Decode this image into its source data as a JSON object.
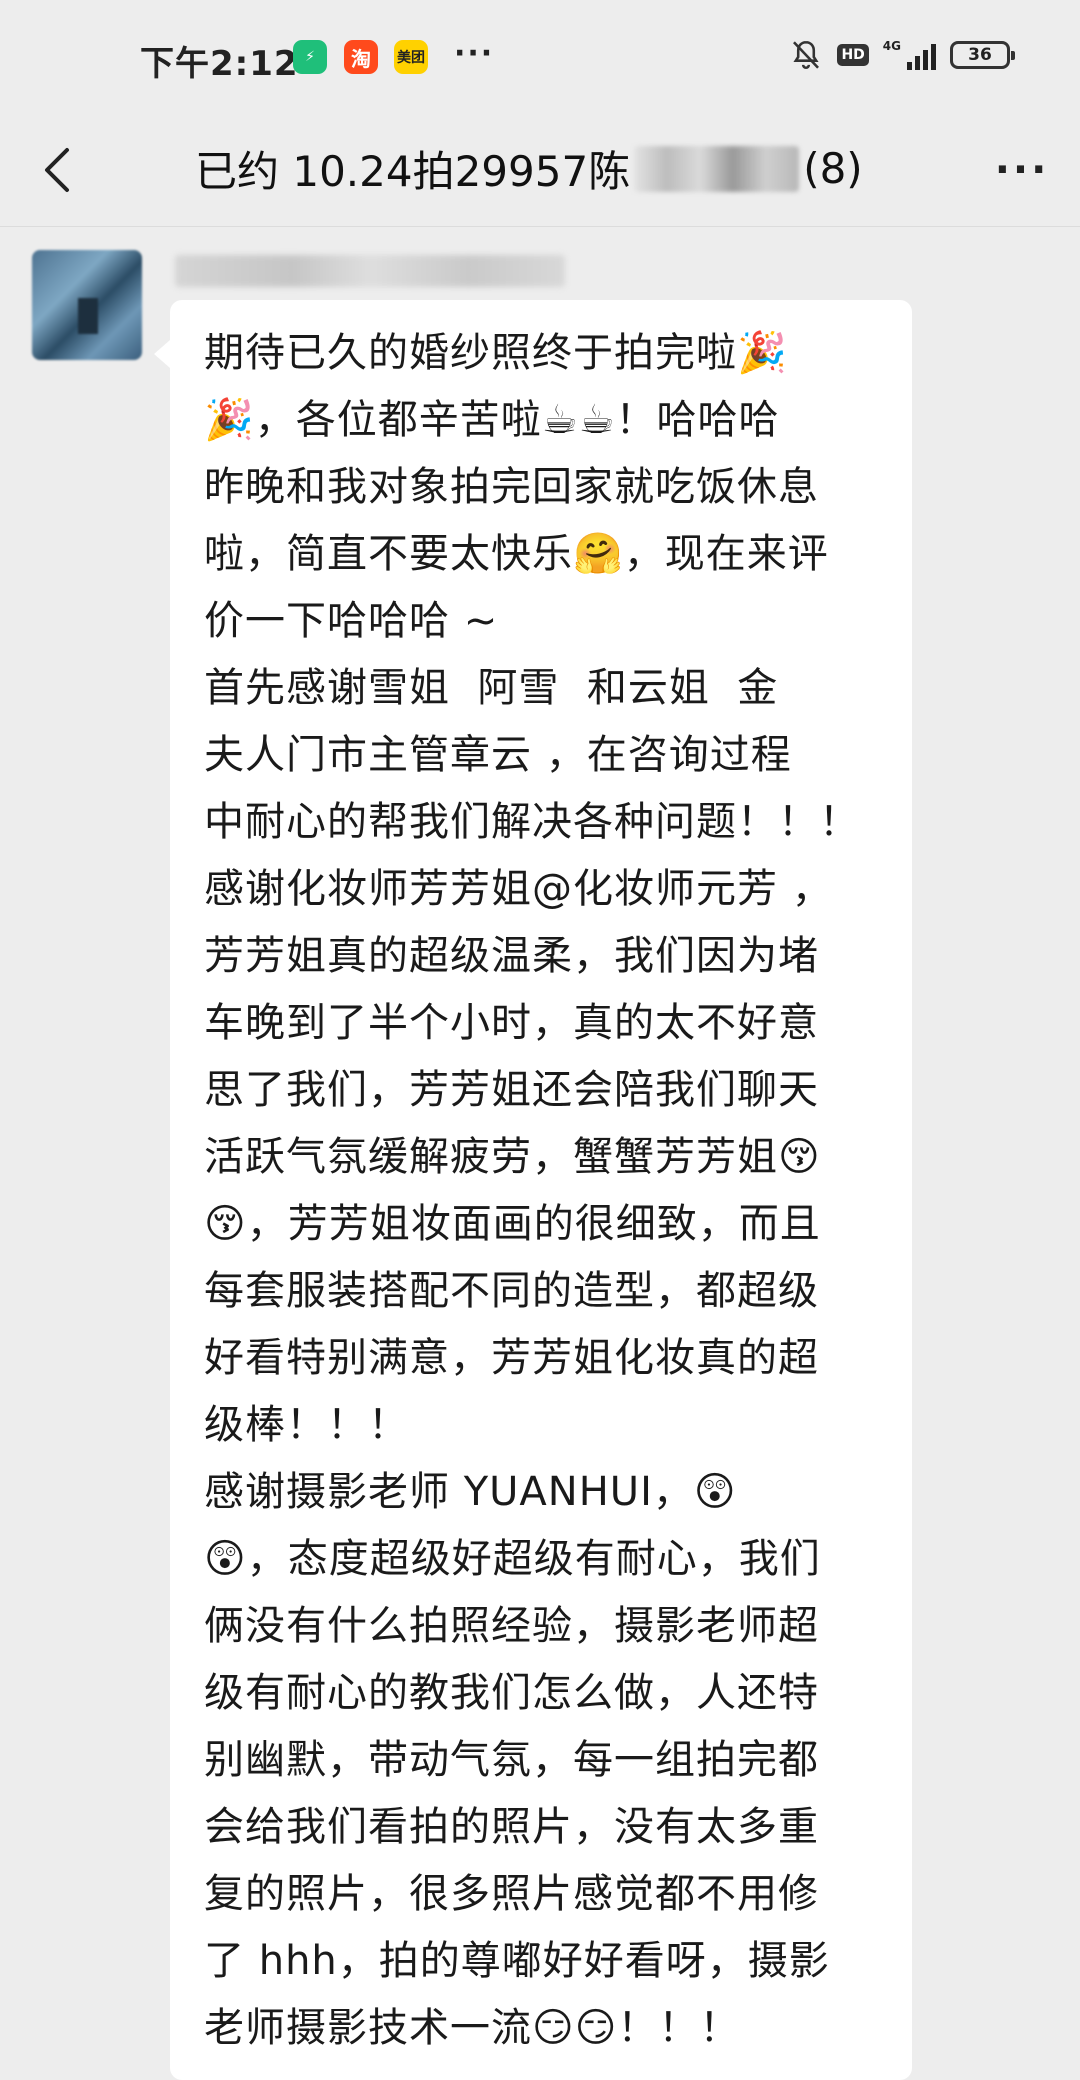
{
  "status_bar": {
    "time": "下午2:12",
    "app_icons": [
      {
        "name": "green-app",
        "glyph": "⚡"
      },
      {
        "name": "taobao",
        "glyph": "淘"
      },
      {
        "name": "meituan",
        "glyph": "美团"
      }
    ],
    "more": "···",
    "hd": "HD",
    "network": "4G",
    "battery": "36"
  },
  "nav": {
    "title_prefix": "已约 10.24拍29957陈",
    "title_suffix": "(8)",
    "menu_glyph": "···"
  },
  "message": {
    "text": "期待已久的婚纱照终于拍完啦🎉\n🎉，各位都辛苦啦☕☕！哈哈哈\n昨晚和我对象拍完回家就吃饭休息\n啦，简直不要太快乐🤗，现在来评\n价一下哈哈哈 ~\n首先感谢雪姐  阿雪  和云姐  金\n夫人门市主管章云 ，在咨询过程\n中耐心的帮我们解决各种问题！！！\n感谢化妆师芳芳姐@化妆师元芳 ，\n芳芳姐真的超级温柔，我们因为堵\n车晚到了半个小时，真的太不好意\n思了我们，芳芳姐还会陪我们聊天\n活跃气氛缓解疲劳，蟹蟹芳芳姐😚\n😚，芳芳姐妆面画的很细致，而且\n每套服装搭配不同的造型，都超级\n好看特别满意，芳芳姐化妆真的超\n级棒！！！\n感谢摄影老师 YUANHUI，😲\n😲，态度超级好超级有耐心，我们\n俩没有什么拍照经验，摄影老师超\n级有耐心的教我们怎么做，人还特\n别幽默，带动气氛，每一组拍完都\n会给我们看拍的照片，没有太多重\n复的照片，很多照片感觉都不用修\n了 hhh，拍的尊嘟好好看呀，摄影\n老师摄影技术一流😏😏！！！"
  }
}
